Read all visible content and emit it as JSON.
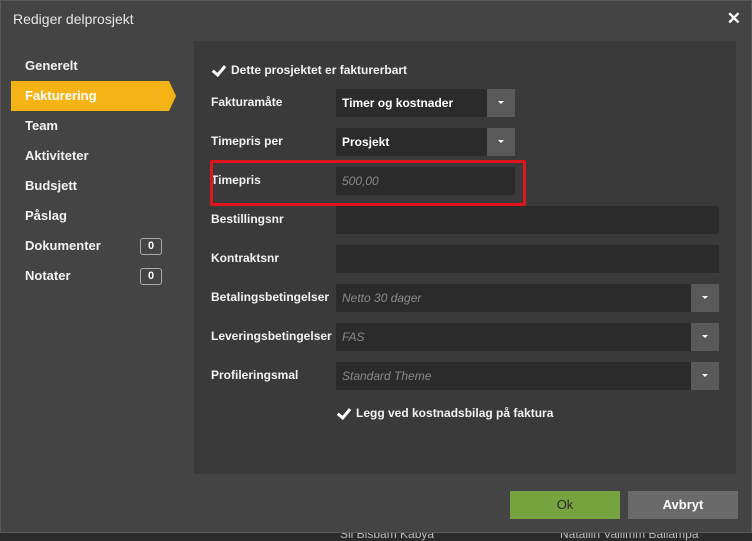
{
  "background": {
    "left_text": "Sil Bisbam Kabya",
    "right_text": "Natallin Vallimm Ballampa"
  },
  "dialog": {
    "title": "Rediger delprosjekt",
    "close_icon": "close-icon"
  },
  "sidebar": {
    "items": [
      {
        "label": "Generelt"
      },
      {
        "label": "Fakturering",
        "active": true
      },
      {
        "label": "Team"
      },
      {
        "label": "Aktiviteter"
      },
      {
        "label": "Budsjett"
      },
      {
        "label": "Påslag"
      },
      {
        "label": "Dokumenter",
        "count": "0"
      },
      {
        "label": "Notater",
        "count": "0"
      }
    ]
  },
  "form": {
    "billable_label": "Dette prosjektet er fakturerbart",
    "billing_method": {
      "label": "Fakturamåte",
      "value": "Timer og kostnader"
    },
    "rate_per": {
      "label": "Timepris per",
      "value": "Prosjekt"
    },
    "hourly_rate": {
      "label": "Timepris",
      "placeholder": "500,00"
    },
    "order_no": {
      "label": "Bestillingsnr",
      "value": ""
    },
    "contract_no": {
      "label": "Kontraktsnr",
      "value": ""
    },
    "payment_terms": {
      "label": "Betalingsbetingelser",
      "placeholder": "Netto 30 dager"
    },
    "delivery_terms": {
      "label": "Leveringsbetingelser",
      "placeholder": "FAS"
    },
    "profile_template": {
      "label": "Profileringsmal",
      "placeholder": "Standard Theme"
    },
    "attach_receipts_label": "Legg ved kostnadsbilag på faktura"
  },
  "footer": {
    "ok_label": "Ok",
    "cancel_label": "Avbryt"
  },
  "colors": {
    "accent": "#f5b316",
    "ok": "#76a33f",
    "highlight": "#e0151b"
  }
}
